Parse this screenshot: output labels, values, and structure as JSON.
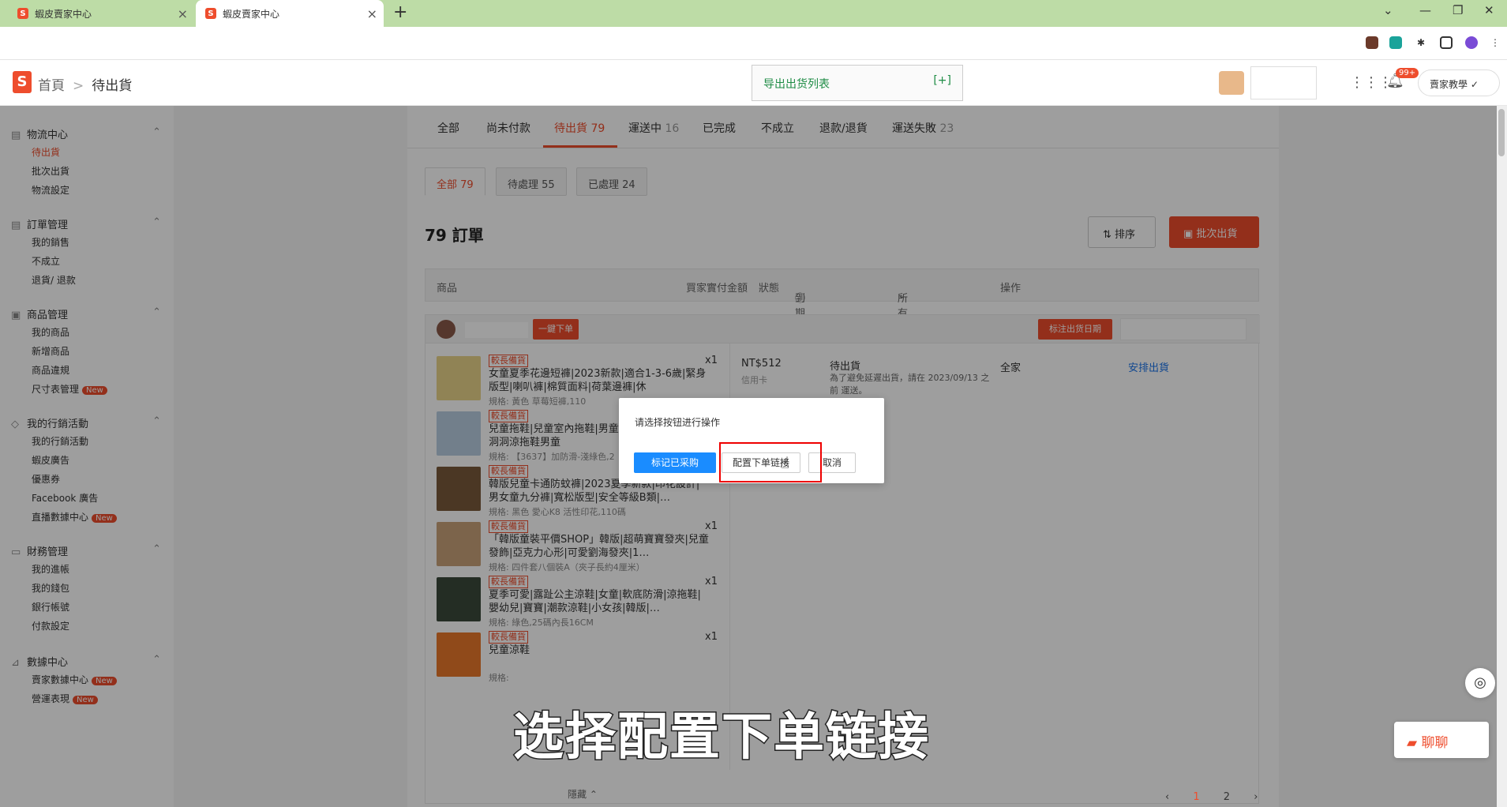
{
  "browser": {
    "tabs": [
      {
        "title": "蝦皮賣家中心"
      },
      {
        "title": "蝦皮賣家中心"
      }
    ],
    "new_tab": "+",
    "controls": {
      "dropdown": "⌄",
      "minimize": "—",
      "restore": "❐",
      "close": "✕"
    }
  },
  "header": {
    "logo": "S",
    "breadcrumb": {
      "home": "首頁",
      "separator": ">",
      "current": "待出貨"
    },
    "export": {
      "label": "导出出货列表",
      "action": "[+]"
    },
    "notification_badge": "99+",
    "tutorial_label": "賣家教學"
  },
  "sidebar": {
    "sections": [
      {
        "title": "物流中心",
        "items": [
          {
            "label": "待出貨",
            "active": true
          },
          {
            "label": "批次出貨"
          },
          {
            "label": "物流設定"
          }
        ]
      },
      {
        "title": "訂單管理",
        "items": [
          {
            "label": "我的銷售"
          },
          {
            "label": "不成立"
          },
          {
            "label": "退貨/ 退款"
          }
        ]
      },
      {
        "title": "商品管理",
        "items": [
          {
            "label": "我的商品"
          },
          {
            "label": "新增商品"
          },
          {
            "label": "商品違規"
          },
          {
            "label": "尺寸表管理",
            "badge": "New"
          }
        ]
      },
      {
        "title": "我的行銷活動",
        "items": [
          {
            "label": "我的行銷活動"
          },
          {
            "label": "蝦皮廣告"
          },
          {
            "label": "優惠券"
          },
          {
            "label": "Facebook 廣告"
          },
          {
            "label": "直播數據中心",
            "badge": "New"
          }
        ]
      },
      {
        "title": "財務管理",
        "items": [
          {
            "label": "我的進帳"
          },
          {
            "label": "我的錢包"
          },
          {
            "label": "銀行帳號"
          },
          {
            "label": "付款設定"
          }
        ]
      },
      {
        "title": "數據中心",
        "items": [
          {
            "label": "賣家數據中心",
            "badge": "New"
          },
          {
            "label": "營運表現",
            "badge": "New"
          }
        ]
      }
    ]
  },
  "tabs": [
    {
      "label": "全部",
      "count": ""
    },
    {
      "label": "尚未付款",
      "count": ""
    },
    {
      "label": "待出貨",
      "count": "79"
    },
    {
      "label": "運送中",
      "count": "16"
    },
    {
      "label": "已完成",
      "count": ""
    },
    {
      "label": "不成立",
      "count": ""
    },
    {
      "label": "退款/退貨",
      "count": ""
    },
    {
      "label": "運送失敗",
      "count": "23"
    }
  ],
  "subtabs": [
    {
      "label": "全部",
      "count": "79"
    },
    {
      "label": "待處理",
      "count": "55"
    },
    {
      "label": "已處理",
      "count": "24"
    }
  ],
  "orders": {
    "title": "79 訂單",
    "sort_label": "排序",
    "batch_label": "批次出貨",
    "columns": {
      "product": "商品",
      "amount": "買家實付金額",
      "status": "狀態",
      "due": "到期時間",
      "shipping": "所有運送方式",
      "action": "操作"
    },
    "quick_order_label": "一鍵下单",
    "mark_date_label": "标注出货日期",
    "products": [
      {
        "tag": "較長備貨",
        "name": "女童夏季花邊短褲|2023新款|適合1-3-6歲|緊身版型|喇叭褲|棉質面料|荷葉邊褲|休",
        "spec": "規格: 黃色 草莓短褲,110",
        "qty": "x1"
      },
      {
        "tag": "較長備貨",
        "name": "兒童拖鞋|兒童室內拖鞋|男童女童可愛寶寶小童洞洞涼拖鞋男童",
        "spec": "規格: 【3637】加防滑-淺綠色,2",
        "qty": "x1"
      },
      {
        "tag": "較長備貨",
        "name": "韓版兒童卡通防蚊褲|2023夏季新款|印花設計|男女童九分褲|寬松版型|安全等級B類|…",
        "spec": "規格: 黑色 愛心K8 活性印花,110碼",
        "qty": "x1"
      },
      {
        "tag": "較長備貨",
        "name": "「韓版童裝平價SHOP」韓版|超萌寶寶發夾|兒童發飾|亞克力心形|可愛劉海發夾|1…",
        "spec": "規格: 四件套八個裝A（夾子長約4厘米）",
        "qty": "x1"
      },
      {
        "tag": "較長備貨",
        "name": "夏季可愛|露趾公主涼鞋|女童|軟底防滑|涼拖鞋|嬰幼兒|寶寶|潮款涼鞋|小女孩|韓版|…",
        "spec": "規格: 綠色,25碼內長16CM",
        "qty": "x1"
      },
      {
        "tag": "較長備貨",
        "name": "兒童涼鞋",
        "spec": "規格:",
        "qty": "x1"
      }
    ],
    "amount": "NT$512",
    "payment_method": "信用卡",
    "status": "待出貨",
    "status_note": "為了避免延遲出貨，請在 2023/09/13 之前 運送。",
    "carrier": "全家",
    "arrange_label": "安排出貨",
    "hide_label": "隱藏 ⌃"
  },
  "pagination": {
    "prev": "‹",
    "pages": [
      "1",
      "2"
    ],
    "next": "›"
  },
  "dialog": {
    "message": "请选择按钮进行操作",
    "mark_purchased": "标记已采购",
    "config_link": "配置下单链接",
    "cancel": "取消"
  },
  "caption": "选择配置下单链接",
  "chat_label": "聊聊",
  "colors": {
    "brand": "#ee4d2d",
    "primary_blue": "#1a8cff",
    "highlight": "#e00000"
  }
}
